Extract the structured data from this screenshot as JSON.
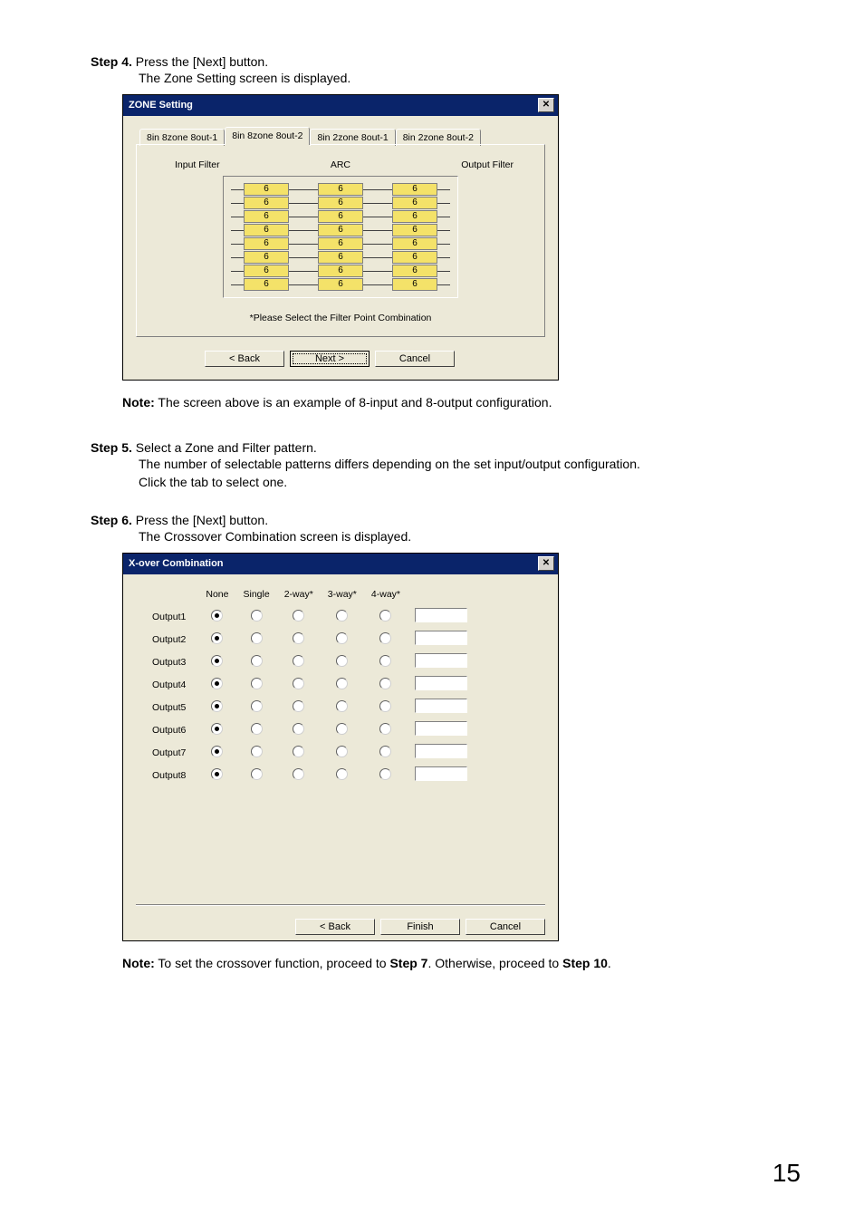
{
  "step4": {
    "label": "Step 4.",
    "line1": "Press the [Next] button.",
    "line2": "The Zone Setting screen is displayed."
  },
  "zone_dialog": {
    "title": "ZONE Setting",
    "tabs": [
      "8in 8zone 8out-1",
      "8in 8zone 8out-2",
      "8in 2zone 8out-1",
      "8in 2zone 8out-2"
    ],
    "active_tab_index": 1,
    "cols": {
      "c1": "Input Filter",
      "c2": "ARC",
      "c3": "Output Filter"
    },
    "box_values": [
      "6",
      "6",
      "6",
      "6",
      "6",
      "6",
      "6",
      "6"
    ],
    "hint": "*Please Select the Filter Point Combination",
    "btn_back": "< Back",
    "btn_next": "Next >",
    "btn_cancel": "Cancel"
  },
  "note1": {
    "label": "Note:",
    "text": " The screen above is an example of 8-input and 8-output configuration."
  },
  "step5": {
    "label": "Step 5.",
    "line1": "Select a Zone and Filter pattern.",
    "line2": "The number of selectable patterns differs depending on the set input/output configuration.",
    "line3": "Click the tab to select one."
  },
  "step6": {
    "label": "Step 6.",
    "line1": "Press the [Next] button.",
    "line2": "The Crossover Combination screen is displayed."
  },
  "xover_dialog": {
    "title": "X-over Combination",
    "headers": [
      "None",
      "Single",
      "2-way*",
      "3-way*",
      "4-way*"
    ],
    "rows": [
      "Output1",
      "Output2",
      "Output3",
      "Output4",
      "Output5",
      "Output6",
      "Output7",
      "Output8"
    ],
    "selected_column": 0,
    "btn_back": "< Back",
    "btn_finish": "Finish",
    "btn_cancel": "Cancel"
  },
  "note2": {
    "label": "Note:",
    "t1": " To set the crossover function, proceed to ",
    "b1": "Step 7",
    "t2": ". Otherwise, proceed to ",
    "b2": "Step 10",
    "t3": "."
  },
  "page_number": "15"
}
